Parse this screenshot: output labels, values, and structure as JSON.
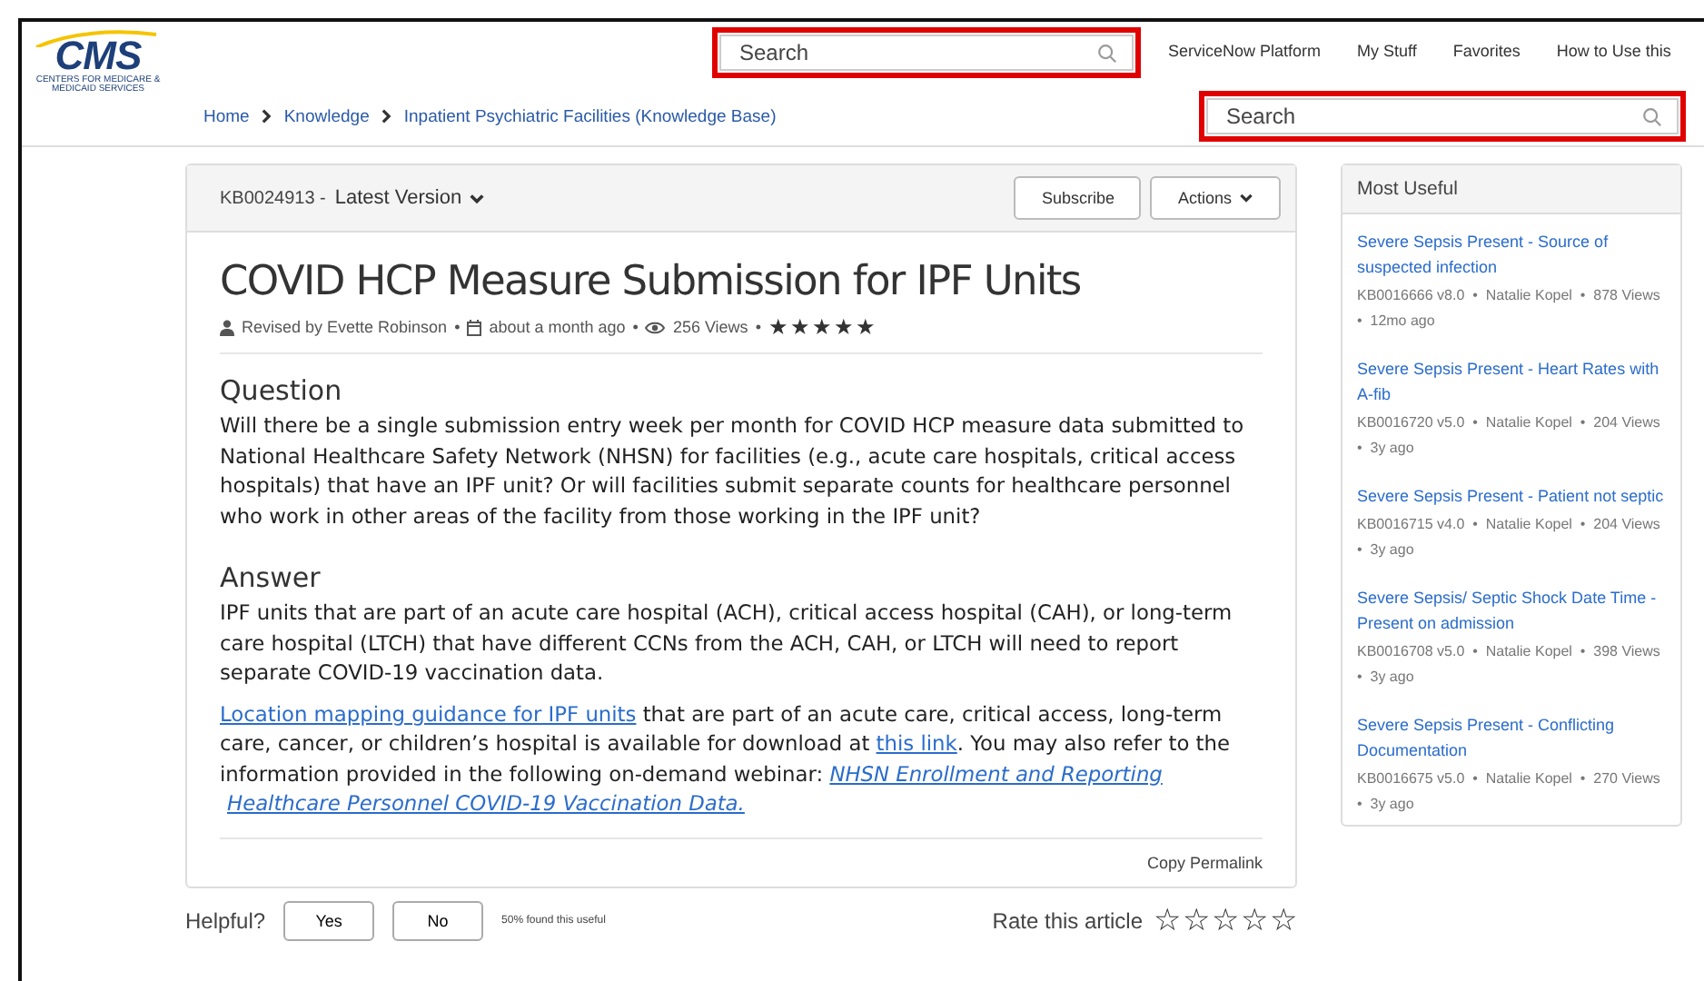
{
  "header": {
    "logo": "CMS",
    "logo_tagline": "CENTERS FOR MEDICARE & MEDICAID SERVICES",
    "search_placeholder": "Search",
    "nav": [
      "ServiceNow Platform",
      "My Stuff",
      "Favorites",
      "How to Use this"
    ]
  },
  "breadcrumb": [
    "Home",
    "Knowledge",
    "Inpatient Psychiatric Facilities (Knowledge Base)"
  ],
  "page_search": {
    "placeholder": "Search"
  },
  "article": {
    "number": "KB0024913 -",
    "version": "Latest Version",
    "buttons": [
      "Subscribe",
      "Actions"
    ],
    "title": "COVID HCP Measure Submission for IPF Units",
    "meta": [
      {
        "kind": "author",
        "text": "Revised by Evette Robinson"
      },
      {
        "kind": "separator",
        "text": "•"
      },
      {
        "kind": "date",
        "text": "about a month ago"
      },
      {
        "kind": "separator",
        "text": "•"
      },
      {
        "kind": "views",
        "text": "256 Views"
      },
      {
        "kind": "separator",
        "text": "•"
      }
    ],
    "stars": 5,
    "sections": [
      {
        "heading": "Question",
        "paragraphs": [
          [
            {
              "kind": "text",
              "text": "Will there be a single submission entry week per month for COVID HCP measure data submitted to National Healthcare Safety Network (NHSN) for facilities (e.g., acute care hospitals, critical access hospitals) that have an IPF unit? Or will facilities submit separate counts for healthcare personnel who work in other areas of the facility from those working in the IPF unit?"
            }
          ]
        ]
      },
      {
        "heading": "Answer",
        "paragraphs": [
          [
            {
              "kind": "text",
              "text": "IPF units that are part of an acute care hospital (ACH), critical access hospital (CAH), or long-term care hospital (LTCH) that have different CCNs from the ACH, CAH, or LTCH will need to report separate COVID-19 vaccination data."
            }
          ],
          [
            {
              "kind": "link",
              "text": "Location mapping guidance for IPF units"
            },
            {
              "kind": "text",
              "text": " that are part of an acute care, critical access, long-term care, cancer, or children’s hospital is available for download at "
            },
            {
              "kind": "link",
              "text": "this link"
            },
            {
              "kind": "text",
              "text": ". You may also refer to the information provided in the following on-demand webinar: "
            },
            {
              "kind": "italic_link",
              "text": "NHSN Enrollment and Reporting"
            },
            {
              "kind": "italic_link",
              "text": "Healthcare Personnel COVID-19 Vaccination Data."
            }
          ]
        ]
      }
    ],
    "permalink": "Copy Permalink"
  },
  "feedback": {
    "label": "Helpful?",
    "buttons": [
      "Yes",
      "No"
    ],
    "note": "50% found this useful",
    "rate_label": "Rate this article",
    "stars": 0
  },
  "sidebar": {
    "title": "Most Useful",
    "items": [
      {
        "title": "Severe Sepsis Present - Source of suspected infection",
        "meta": "KB0016666 v8.0  •  Natalie Kopel  •  878 Views  •  12mo ago"
      },
      {
        "title": "Severe Sepsis Present - Heart Rates with A-fib",
        "meta": "KB0016720 v5.0  •  Natalie Kopel  •  204 Views  •  3y ago"
      },
      {
        "title": "Severe Sepsis Present - Patient not septic",
        "meta": "KB0016715 v4.0  •  Natalie Kopel  •  204 Views  •  3y ago"
      },
      {
        "title": "Severe Sepsis/ Septic Shock Date Time - Present on admission",
        "meta": "KB0016708 v5.0  •  Natalie Kopel  •  398 Views  •  3y ago"
      },
      {
        "title": "Severe Sepsis Present - Conflicting Documentation",
        "meta": "KB0016675 v5.0  •  Natalie Kopel  •  270 Views  •  3y ago"
      }
    ]
  }
}
